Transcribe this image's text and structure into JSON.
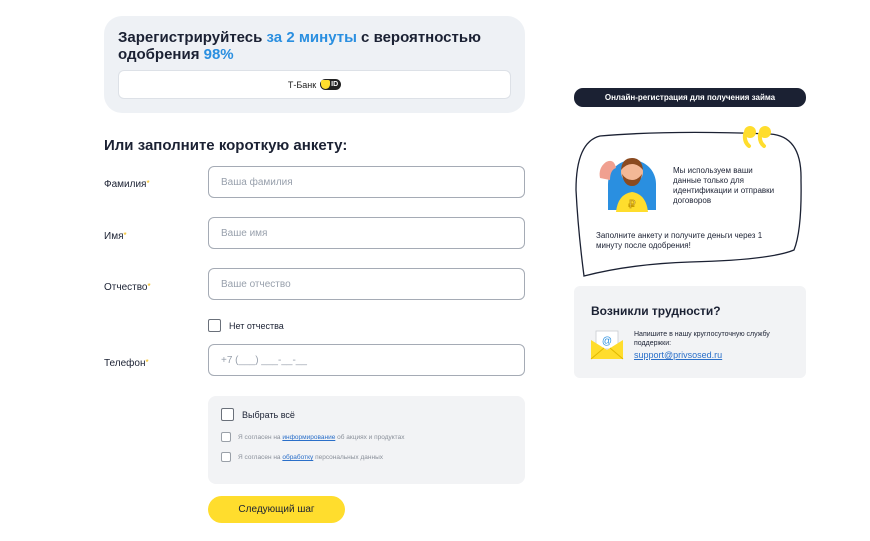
{
  "promo": {
    "title_start": "Зарегистрируйтесь ",
    "title_highlight1": "за 2 минуты",
    "title_middle": " с вероятностью одобрения ",
    "title_highlight2": "98%",
    "tbank_label": "Т-Банк",
    "tid_label": "ID"
  },
  "form": {
    "title": "Или заполните короткую анкету:",
    "required_mark": "*",
    "surname": {
      "label": "Фамилия",
      "placeholder": "Ваша фамилия"
    },
    "name": {
      "label": "Имя",
      "placeholder": "Ваше имя"
    },
    "patronymic": {
      "label": "Отчество",
      "placeholder": "Ваше отчество"
    },
    "no_patronymic_label": "Нет отчества",
    "phone": {
      "label": "Телефон",
      "placeholder": "+7 (___) ___-__-__"
    },
    "select_all_label": "Выбрать всё",
    "consent1_pre": "Я согласен на ",
    "consent1_link": "информирование",
    "consent1_post": " об акциях и продуктах",
    "consent2_pre": "Я согласен на ",
    "consent2_link": "обработку",
    "consent2_post": " персональных данных",
    "next_button": "Следующий шаг"
  },
  "sidebar": {
    "badge": "Онлайн-регистрация для получения займа",
    "bubble_text1": "Мы используем ваши данные только для идентификации и отправки договоров",
    "bubble_text2": "Заполните анкету и получите деньги через 1 минуту после одобрения!",
    "support_title": "Возникли трудности?",
    "support_text": "Напишите в нашу круглосуточную службу поддержки:",
    "support_email": "support@privsosed.ru"
  },
  "colors": {
    "accent_yellow": "#ffdd2d",
    "accent_blue": "#2a8fe0",
    "dark": "#1b2133",
    "link": "#2a6fc9"
  },
  "icons": [
    "tid-shield-icon",
    "quote-icon",
    "avatar-icon",
    "ruble-icon",
    "envelope-icon"
  ]
}
